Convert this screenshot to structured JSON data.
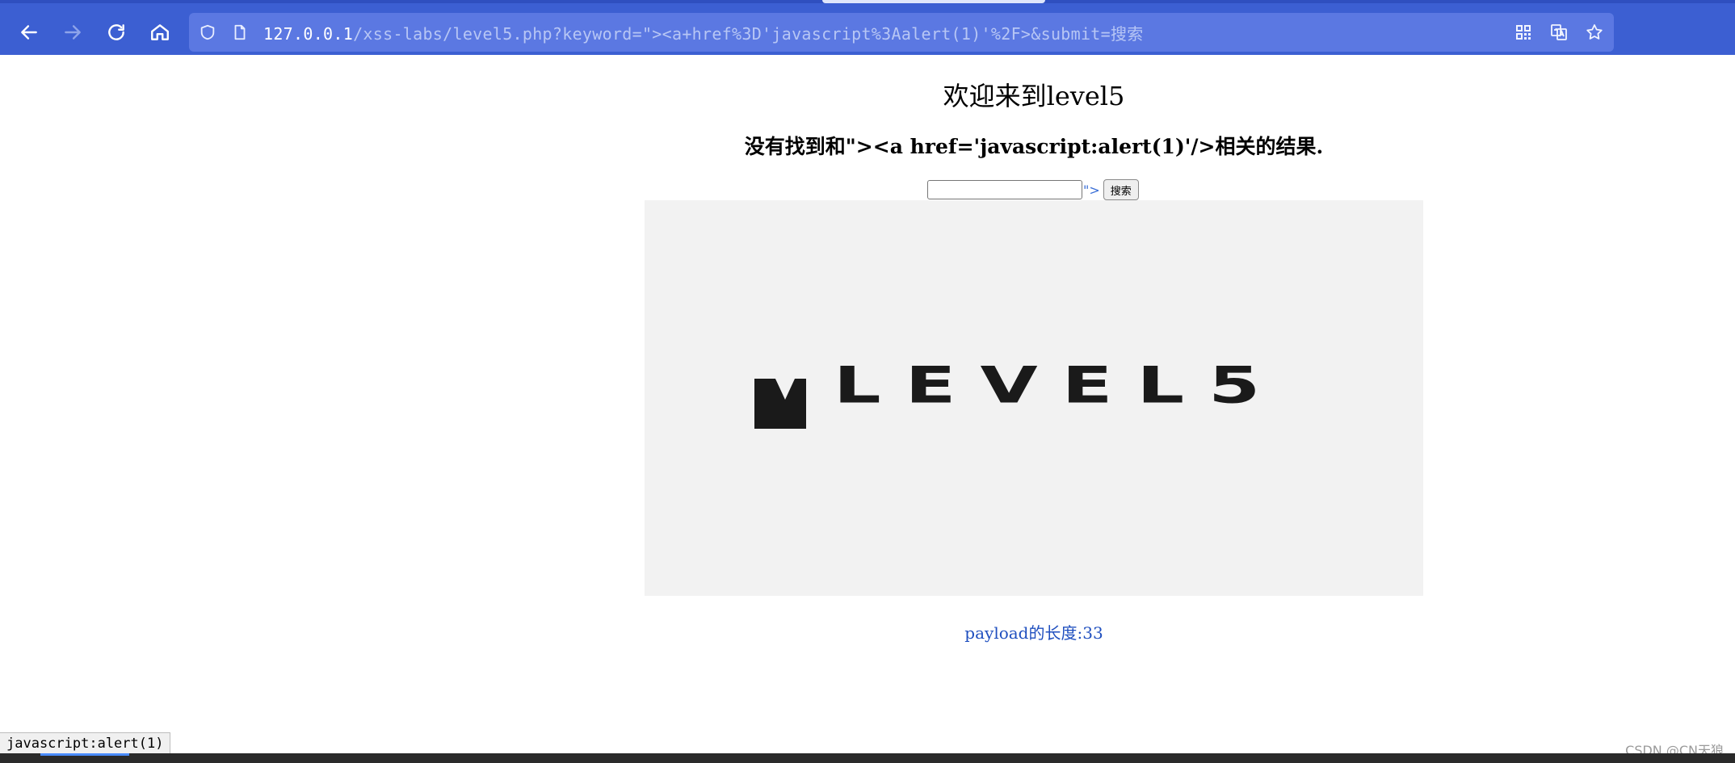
{
  "browser": {
    "url_host": "127.0.0.1",
    "url_path": "/xss-labs/level5.php?keyword=\"><a+href%3D'javascript%3Aalert(1)'%2F>&submit=搜索"
  },
  "page": {
    "heading": "欢迎来到level5",
    "result_message": "没有找到和\"><a href='javascript:alert(1)'/>相关的结果.",
    "keyword_input_value": "",
    "stray_text": "\">",
    "search_button_label": "搜索",
    "logo_text": "LEVEL5",
    "payload_length": "payload的长度:33"
  },
  "status_bar": {
    "link_preview": "javascript:alert(1)",
    "watermark": "CSDN @CN天狼"
  },
  "colors": {
    "toolbar": "#3c5fd2",
    "urlbar": "#5b78e2",
    "link": "#1f4fbf"
  },
  "icons": [
    "back-arrow-icon",
    "forward-arrow-icon",
    "reload-icon",
    "home-icon",
    "shield-icon",
    "page-icon",
    "qr-code-icon",
    "translate-icon",
    "star-icon"
  ]
}
